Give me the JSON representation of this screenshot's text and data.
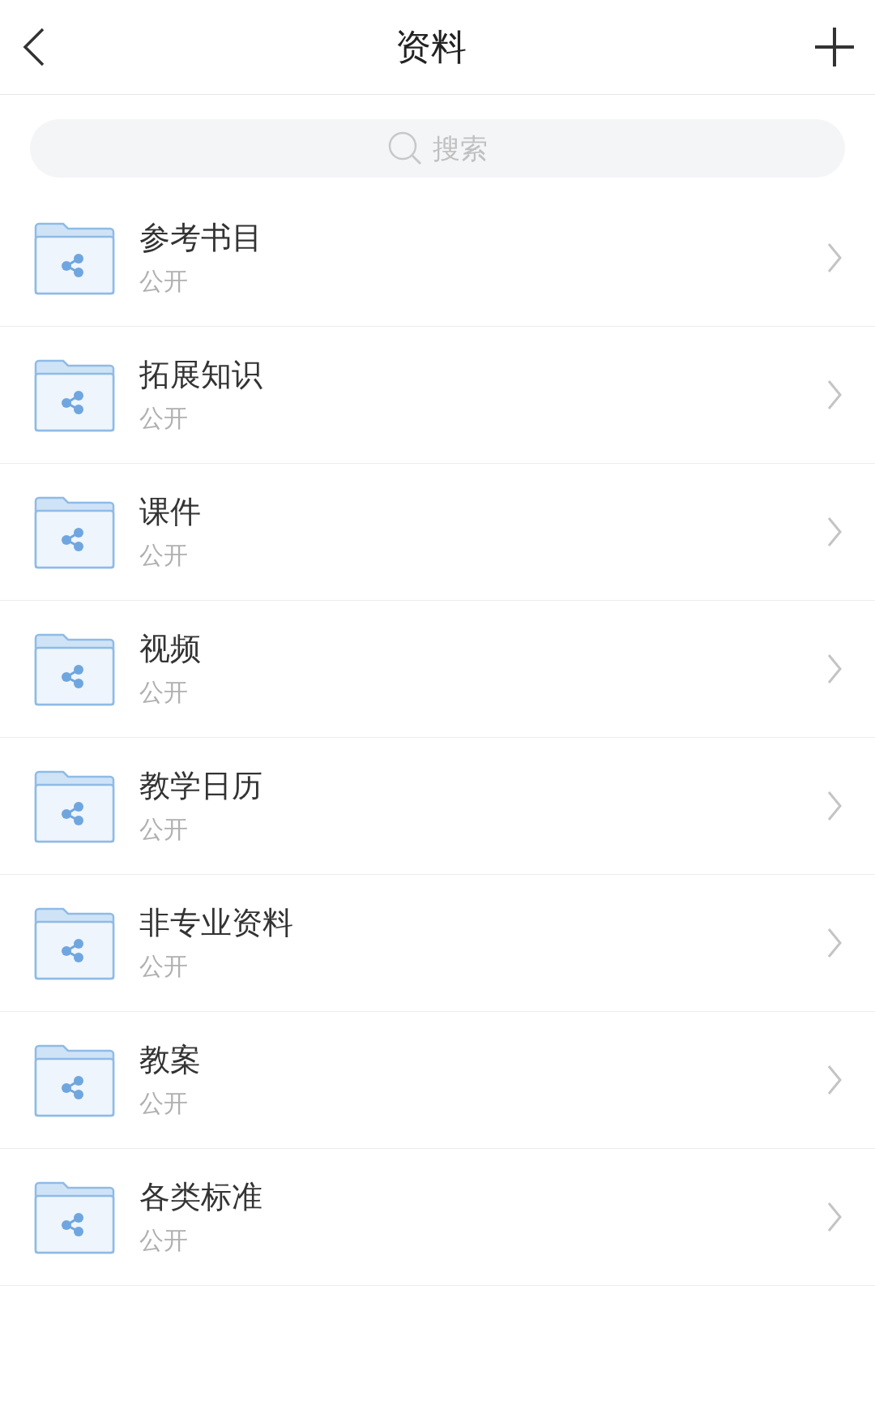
{
  "header": {
    "title": "资料"
  },
  "search": {
    "placeholder": "搜索"
  },
  "folders": [
    {
      "name": "参考书目",
      "visibility": "公开"
    },
    {
      "name": "拓展知识",
      "visibility": "公开"
    },
    {
      "name": "课件",
      "visibility": "公开"
    },
    {
      "name": "视频",
      "visibility": "公开"
    },
    {
      "name": "教学日历",
      "visibility": "公开"
    },
    {
      "name": "非专业资料",
      "visibility": "公开"
    },
    {
      "name": "教案",
      "visibility": "公开"
    },
    {
      "name": "各类标准",
      "visibility": "公开"
    }
  ]
}
